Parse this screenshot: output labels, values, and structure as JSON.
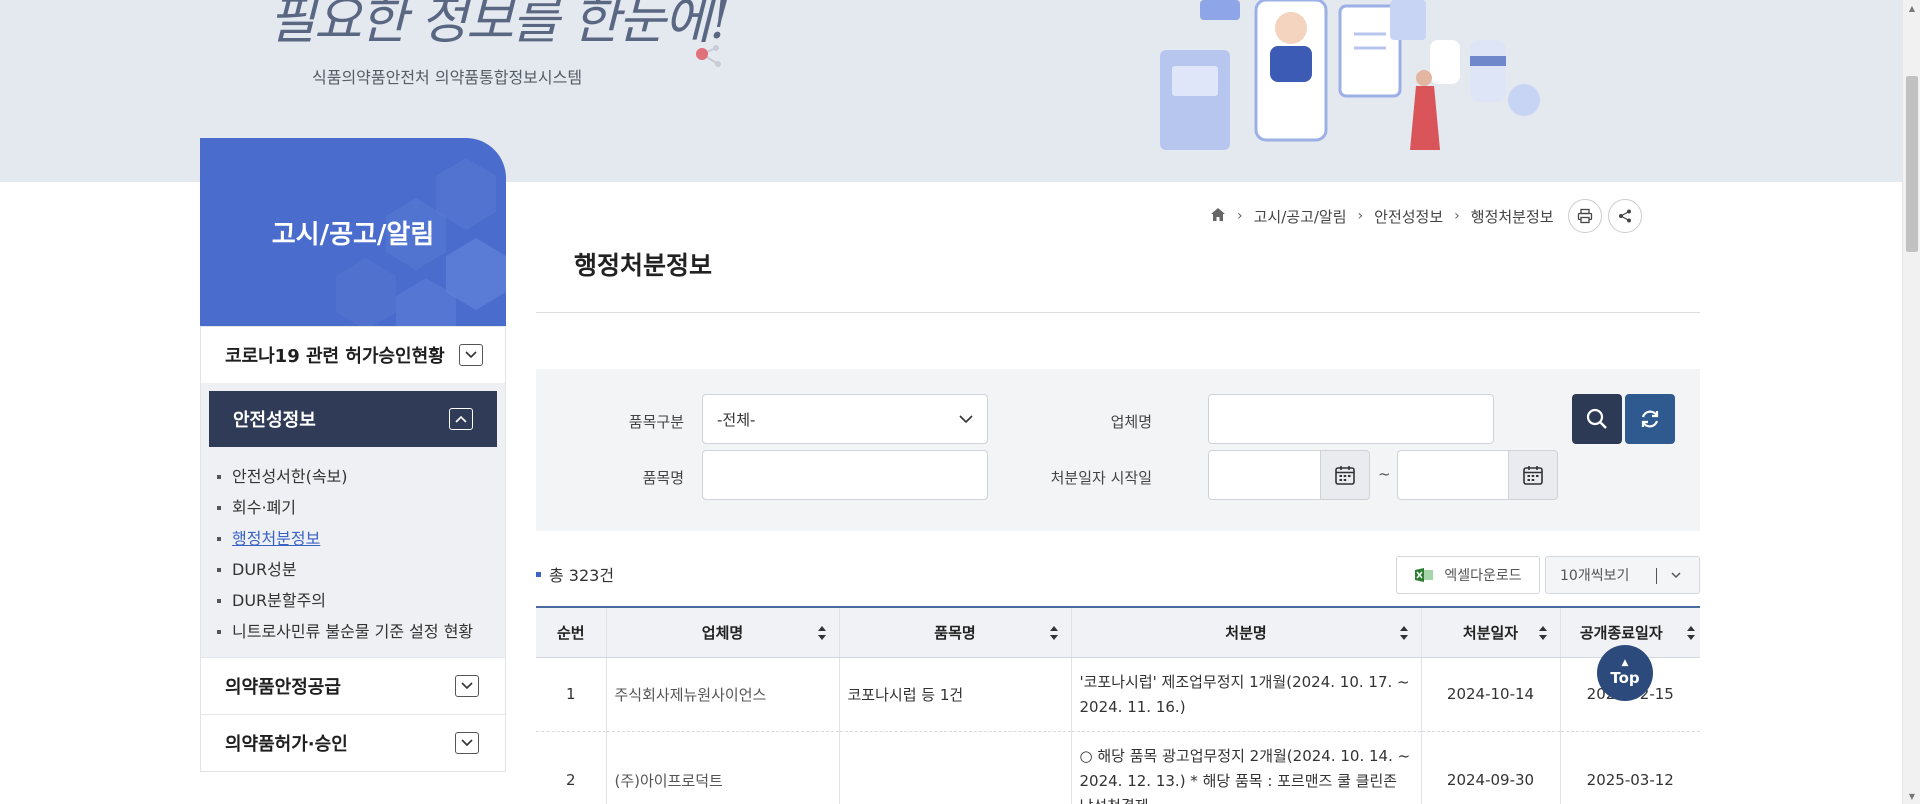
{
  "banner": {
    "slogan": "필요한 정보를 한눈에!",
    "subtitle": "식품의약품안전처 의약품통합정보시스템"
  },
  "sidebar": {
    "title": "고시/공고/알림",
    "menu": [
      {
        "label": "코로나19 관련 허가승인현황",
        "expanded": false
      },
      {
        "label": "안전성정보",
        "expanded": true
      },
      {
        "label": "의약품안정공급",
        "expanded": false
      },
      {
        "label": "의약품허가·승인",
        "expanded": false
      }
    ],
    "submenu": [
      {
        "label": "안전성서한(속보)"
      },
      {
        "label": "회수·폐기"
      },
      {
        "label": "행정처분정보",
        "current": true
      },
      {
        "label": "DUR성분"
      },
      {
        "label": "DUR분할주의"
      },
      {
        "label": "니트로사민류 불순물 기준 설정 현황"
      }
    ]
  },
  "breadcrumb": {
    "items": [
      "고시/공고/알림",
      "안전성정보",
      "행정처분정보"
    ]
  },
  "page": {
    "title": "행정처분정보"
  },
  "search": {
    "product_type_label": "품목구분",
    "product_type_value": "-전체-",
    "company_label": "업체명",
    "company_value": "",
    "product_name_label": "품목명",
    "product_name_value": "",
    "date_label": "처분일자 시작일",
    "date_start": "",
    "date_end": "",
    "tilde": "~"
  },
  "results": {
    "total": "총 323건",
    "excel_label": "엑셀다운로드",
    "view_label": "10개씩보기"
  },
  "table": {
    "headers": [
      "순번",
      "업체명",
      "품목명",
      "처분명",
      "처분일자",
      "공개종료일자"
    ],
    "rows": [
      {
        "no": "1",
        "company": "주식회사제뉴원사이언스",
        "product": "코포나시럽 등 1건",
        "action": "'코포나시럽' 제조업무정지 1개월(2024. 10. 17. ~ 2024. 11. 16.)",
        "date": "2024-10-14",
        "end_date": "2025-02-15"
      },
      {
        "no": "2",
        "company": "(주)아이프로덕트",
        "product": "",
        "action": "○ 해당 품목 광고업무정지 2개월(2024. 10. 14. ~ 2024. 12. 13.) * 해당 품목 : 포르맨즈 쿨 클린존 남성청결제",
        "date": "2024-09-30",
        "end_date": "2025-03-12"
      }
    ]
  },
  "top_button": {
    "label": "Top"
  },
  "colors": {
    "sidebar_head": "#4a6ccc",
    "active_menu": "#2f3b57",
    "search_button": "#2d3a55",
    "reset_button": "#2f5a8f",
    "table_border": "#4a6ba0",
    "top_button": "#2c4a7c"
  }
}
